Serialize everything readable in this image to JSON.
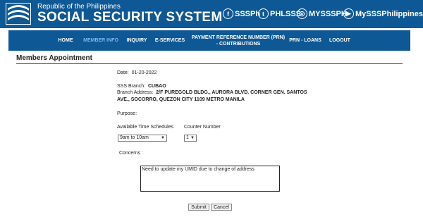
{
  "header": {
    "republic": "Republic of the Philippines",
    "title": "SOCIAL SECURITY SYSTEM",
    "social": [
      {
        "icon": "facebook-icon",
        "glyph": "f",
        "label": "SSSPh"
      },
      {
        "icon": "twitter-icon",
        "glyph": "t",
        "label": "PHLSSS"
      },
      {
        "icon": "instagram-icon",
        "glyph": "◎",
        "label": "MYSSSPH"
      },
      {
        "icon": "youtube-icon",
        "glyph": "▶",
        "label": "MySSSPhilippines"
      }
    ]
  },
  "nav": {
    "items": [
      {
        "label": "HOME"
      },
      {
        "label": "MEMBER INFO",
        "active": true
      },
      {
        "label": "INQUIRY"
      },
      {
        "label": "E-SERVICES"
      },
      {
        "label": "PAYMENT REFERENCE NUMBER (PRN) - CONTRIBUTIONS"
      },
      {
        "label": "PRN - LOANS"
      },
      {
        "label": "LOGOUT"
      }
    ]
  },
  "page": {
    "title": "Members Appointment"
  },
  "form": {
    "date_label": "Date:",
    "date_value": "01-20-2022",
    "branch_label": "SSS Branch:",
    "branch_value": "CUBAO",
    "address_label": "Branch Address:",
    "address_line1": "2/F PUREGOLD BLDG., AURORA BLVD. CORNER GEN. SANTOS",
    "address_line2": "AVE., SOCORRO, QUEZON CITY 1109 METRO MANILA",
    "purpose_label": "Purpose:",
    "schedule_label": "Available Time Schedules",
    "schedule_value": "9am to 10am",
    "counter_label": "Counter Number",
    "counter_value": "1",
    "concerns_label": "Concerns :",
    "concerns_value": "Need to update my UMID due to change of address",
    "submit_label": "Submit",
    "cancel_label": "Cancel"
  },
  "colors": {
    "brand": "#0e5895",
    "active_nav": "#7fb8ea"
  }
}
